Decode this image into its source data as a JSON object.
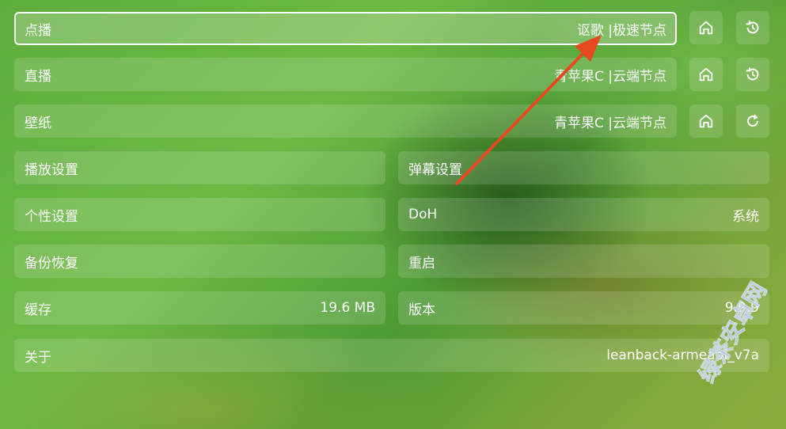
{
  "rows": {
    "vod": {
      "label": "点播",
      "value": "讴歌  |极速节点"
    },
    "live": {
      "label": "直播",
      "value": "青苹果C |云端节点"
    },
    "wallpaper": {
      "label": "壁纸",
      "value": "青苹果C |云端节点"
    },
    "playback": {
      "label": "播放设置"
    },
    "danmaku": {
      "label": "弹幕设置"
    },
    "personal": {
      "label": "个性设置"
    },
    "doh": {
      "label": "DoH",
      "value": "系统"
    },
    "backup": {
      "label": "备份恢复"
    },
    "restart": {
      "label": "重启"
    },
    "cache": {
      "label": "缓存",
      "value": "19.6 MB"
    },
    "version": {
      "label": "版本",
      "value": "9.9.9"
    },
    "about": {
      "label": "关于",
      "value": "leanback-armeabi_v7a"
    }
  },
  "icons": {
    "vod_home": "home-icon",
    "vod_history": "history-icon",
    "live_home": "home-icon",
    "live_history": "history-icon",
    "wall_home": "home-icon",
    "wall_refresh": "refresh-icon"
  },
  "watermark": {
    "text": "绿茶安卓网"
  },
  "colors": {
    "arrow": "#e84a1f",
    "focus_border": "#ffffff"
  }
}
